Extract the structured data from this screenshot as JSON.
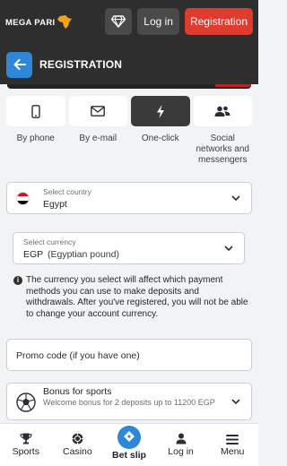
{
  "header": {
    "logo_text": "MEGA PARI",
    "login_label": "Log in",
    "register_label": "Registration"
  },
  "page": {
    "title": "REGISTRATION"
  },
  "tabs": [
    {
      "label": "By phone",
      "icon": "phone-icon"
    },
    {
      "label": "By e-mail",
      "icon": "envelope-icon"
    },
    {
      "label": "One-click",
      "icon": "lightning-icon",
      "active": true
    },
    {
      "label": "Social networks and messengers",
      "icon": "people-icon"
    }
  ],
  "country": {
    "caption": "Select country",
    "value": "Egypt"
  },
  "currency": {
    "caption": "Select currency",
    "code": "EGP",
    "name": "(Egyptian pound)"
  },
  "notice": "The currency you select will affect which payment methods you can use to make deposits and withdrawals. After you've registered, you will not be able to change your account currency.",
  "promo": {
    "placeholder": "Promo code (if you have one)"
  },
  "bonus": {
    "title": "Bonus for sports",
    "description": "Welcome bonus for 2 deposits up to 11200 EGP"
  },
  "bottom_nav": {
    "sports": "Sports",
    "casino": "Casino",
    "betslip": "Bet slip",
    "login": "Log in",
    "menu": "Menu"
  },
  "colors": {
    "accent_blue": "#2f87d7",
    "register_red": "#e03b2f",
    "header_dark": "#2e2e2e"
  }
}
